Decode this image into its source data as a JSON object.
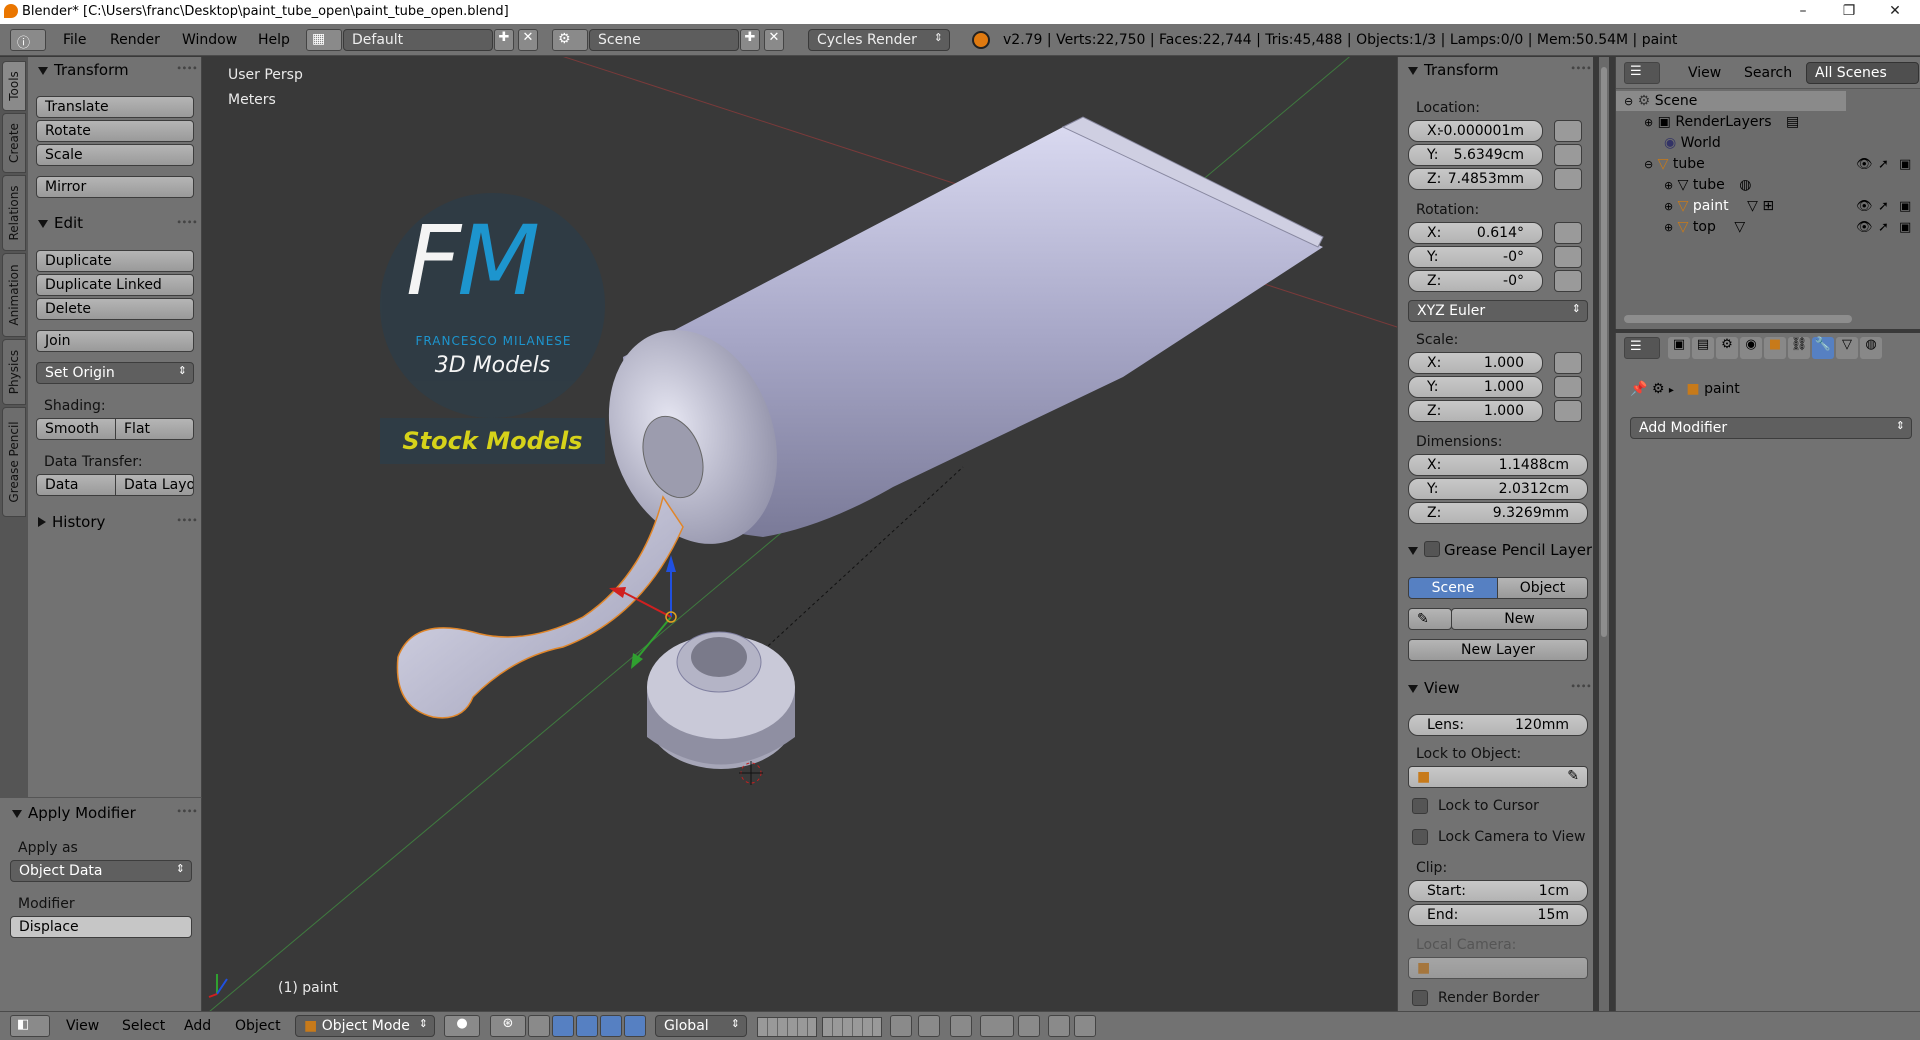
{
  "titlebar": {
    "title": "Blender* [C:\\Users\\franc\\Desktop\\paint_tube_open\\paint_tube_open.blend]",
    "minimize": "–",
    "maximize": "❐",
    "close": "✕"
  },
  "info_header": {
    "menus": [
      "File",
      "Render",
      "Window",
      "Help"
    ],
    "screen_layout": "Default",
    "scene": "Scene",
    "render_engine": "Cycles Render",
    "stats": "v2.79 | Verts:22,750 | Faces:22,744 | Tris:45,488 | Objects:1/3 | Lamps:0/0 | Mem:50.54M | paint"
  },
  "tool_tabs": [
    "Tools",
    "Create",
    "Relations",
    "Animation",
    "Physics",
    "Grease Pencil"
  ],
  "toolshelf": {
    "transform": {
      "title": "Transform",
      "buttons": [
        "Translate",
        "Rotate",
        "Scale",
        "Mirror"
      ]
    },
    "edit": {
      "title": "Edit",
      "buttons": [
        "Duplicate",
        "Duplicate Linked",
        "Delete",
        "Join"
      ],
      "set_origin": "Set Origin",
      "shading_label": "Shading:",
      "shading_smooth": "Smooth",
      "shading_flat": "Flat",
      "data_transfer_label": "Data Transfer:",
      "data": "Data",
      "data_layout": "Data Layo"
    },
    "history": {
      "title": "History"
    }
  },
  "operator_panel": {
    "title": "Apply Modifier",
    "apply_as_label": "Apply as",
    "apply_as_value": "Object Data",
    "modifier_label": "Modifier",
    "modifier_value": "Displace"
  },
  "viewport": {
    "view_name": "User Persp",
    "units": "Meters",
    "object_label": "(1) paint",
    "watermark": {
      "brand_f": "F",
      "brand_m": "M",
      "brand_name": "FRANCESCO MILANESE",
      "brand_sub": "3D Models",
      "banner": "Stock Models"
    },
    "colors": {
      "watermark_blue": "#1c9ad6",
      "banner_yellow": "#d6d21a"
    }
  },
  "npanel": {
    "transform_title": "Transform",
    "location_label": "Location:",
    "location": {
      "x": "-0.000001m",
      "y": "5.6349cm",
      "z": "7.4853mm"
    },
    "rotation_label": "Rotation:",
    "rotation": {
      "x": "0.614°",
      "y": "-0°",
      "z": "-0°"
    },
    "rotation_mode": "XYZ Euler",
    "scale_label": "Scale:",
    "scale": {
      "x": "1.000",
      "y": "1.000",
      "z": "1.000"
    },
    "dimensions_label": "Dimensions:",
    "dimensions": {
      "x": "1.1488cm",
      "y": "2.0312cm",
      "z": "9.3269mm"
    },
    "axis": {
      "x": "X:",
      "y": "Y:",
      "z": "Z:"
    },
    "grease_title": "Grease Pencil Layer",
    "grease_scene": "Scene",
    "grease_object": "Object",
    "grease_new": "New",
    "grease_new_layer": "New Layer",
    "view_title": "View",
    "lens_label": "Lens:",
    "lens_value": "120mm",
    "lock_to_object": "Lock to Object:",
    "lock_to_cursor": "Lock to Cursor",
    "lock_camera": "Lock Camera to View",
    "clip_label": "Clip:",
    "clip_start_label": "Start:",
    "clip_start": "1cm",
    "clip_end_label": "End:",
    "clip_end": "15m",
    "local_camera": "Local Camera:",
    "render_border": "Render Border"
  },
  "outliner": {
    "header": {
      "view": "View",
      "search": "Search",
      "filter": "All Scenes"
    },
    "rows": [
      "Scene",
      "RenderLayers",
      "World",
      "tube",
      "tube",
      "paint",
      "top"
    ]
  },
  "properties": {
    "breadcrumb_object": "paint",
    "add_modifier": "Add Modifier"
  },
  "bottom_bar": {
    "menus": [
      "View",
      "Select",
      "Add",
      "Object"
    ],
    "mode": "Object Mode",
    "orientation": "Global"
  }
}
